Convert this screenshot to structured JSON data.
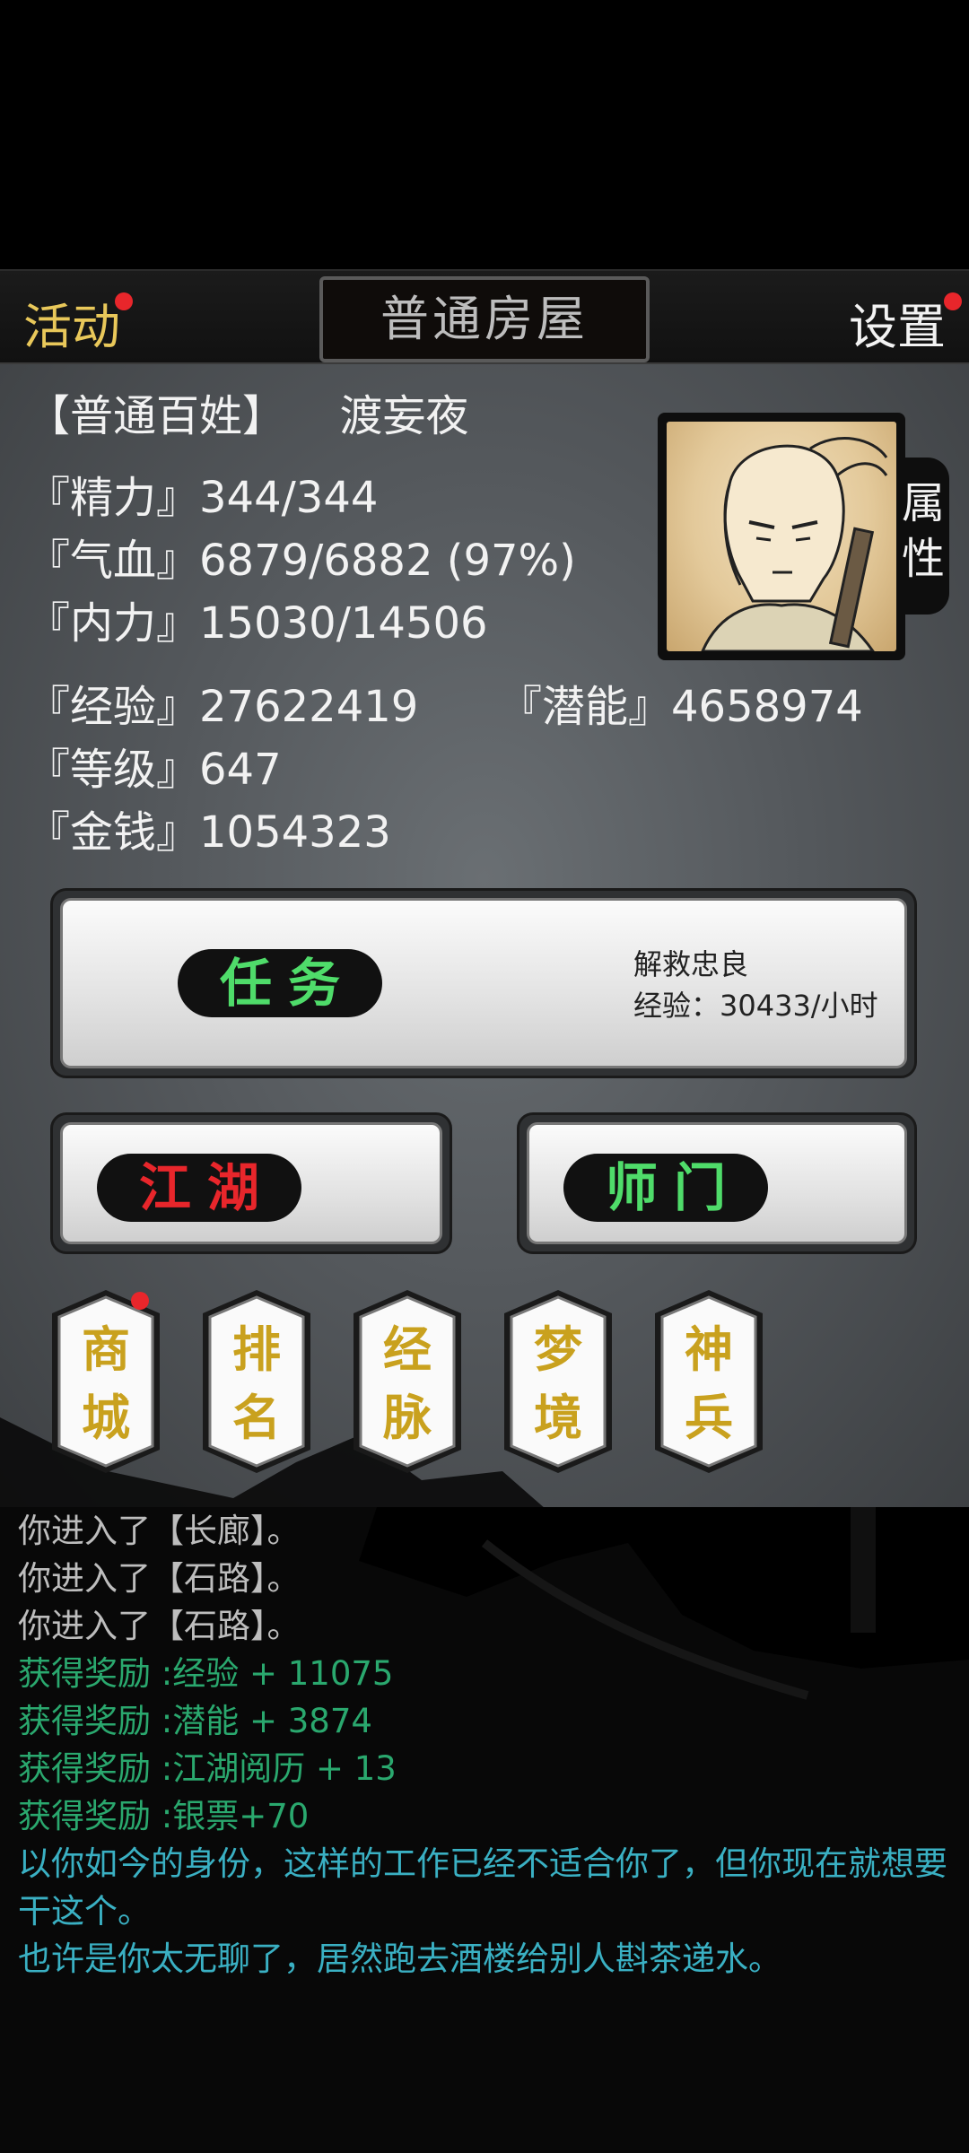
{
  "topbar": {
    "activity_label": "活动",
    "location": "普通房屋",
    "settings_label": "设置"
  },
  "player": {
    "rank": "【普通百姓】",
    "name": "渡妄夜",
    "stats": {
      "stamina": "『精力』344/344",
      "health": "『气血』6879/6882 (97%)",
      "internal": "『内力』15030/14506",
      "experience": "『经验』27622419",
      "potential": "『潜能』4658974",
      "level": "『等级』647",
      "money": "『金钱』1054323"
    },
    "attr_tab_label": "属性"
  },
  "buttons": {
    "task": "任务",
    "task_name": "解救忠良",
    "task_rate": "经验：30433/小时",
    "jianghu": "江湖",
    "shimen": "师门",
    "shop": [
      "商",
      "城"
    ],
    "ranking": [
      "排",
      "名"
    ],
    "meridian": [
      "经",
      "脉"
    ],
    "dream": [
      "梦",
      "境"
    ],
    "weapon": [
      "神",
      "兵"
    ]
  },
  "log": [
    {
      "text": "你进入了【长廊】。",
      "color": "#bdbdbd"
    },
    {
      "text": "你进入了【石路】。",
      "color": "#bdbdbd"
    },
    {
      "text": "你进入了【石路】。",
      "color": "#bdbdbd"
    },
    {
      "text": "获得奖励 :经验 + 11075",
      "color": "#2aa86e"
    },
    {
      "text": "获得奖励 :潜能 + 3874",
      "color": "#2aa86e"
    },
    {
      "text": "获得奖励 :江湖阅历 + 13",
      "color": "#2aa86e"
    },
    {
      "text": "获得奖励 :银票+70",
      "color": "#2aa86e"
    },
    {
      "text": "以你如今的身份，这样的工作已经不适合你了，但你现在就想要干这个。",
      "color": "#3ab0c3"
    },
    {
      "text": "也许是你太无聊了，居然跑去酒楼给别人斟茶递水。",
      "color": "#3ab0c3"
    }
  ],
  "colors": {
    "gold": "#e9c85a",
    "green_text": "#4fdc6a",
    "red_text": "#e8262b",
    "reward_green": "#2aa86e",
    "story_cyan": "#3ab0c3",
    "notify_dot": "#e8262b"
  }
}
